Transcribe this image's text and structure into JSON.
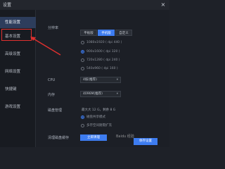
{
  "window": {
    "title": "设置",
    "close": "×"
  },
  "sidebar": {
    "items": [
      {
        "label": "性能设置",
        "active": true
      },
      {
        "label": "基本设置",
        "active": false
      },
      {
        "label": "高级设置",
        "active": false
      },
      {
        "label": "网络设置",
        "active": false
      },
      {
        "label": "快捷键",
        "active": false
      },
      {
        "label": "游戏设置",
        "active": false
      }
    ]
  },
  "resolution": {
    "label": "分辨率",
    "modes": [
      "平板版",
      "手机版",
      "自定义"
    ],
    "active_mode": "手机版",
    "options": [
      {
        "text": "1080x1920 ( dpi 440 )",
        "checked": false
      },
      {
        "text": "900x1600 ( dpi 320 )",
        "checked": true
      },
      {
        "text": "720x1280 ( dpi 240 )",
        "checked": false
      },
      {
        "text": "540x960 ( dpi 160 )",
        "checked": false
      }
    ]
  },
  "cpu": {
    "label": "CPU",
    "value": "4核(推荐)"
  },
  "memory": {
    "label": "内存",
    "value": "4096M(推荐)"
  },
  "disk": {
    "label": "磁盘管理",
    "info": "最大大 12 G，剩余 8 G",
    "options": [
      {
        "text": "磁盘共享模式",
        "checked": true
      },
      {
        "text": "多存空间随需扩充",
        "checked": false
      }
    ]
  },
  "cleanup": {
    "label": "清理磁盘缓存",
    "button": "立即清理"
  },
  "footer": {
    "save": "保存设置"
  },
  "watermark": "Baidu 经验",
  "colors": {
    "accent": "#3d7cf0",
    "highlight": "#e0302f"
  }
}
